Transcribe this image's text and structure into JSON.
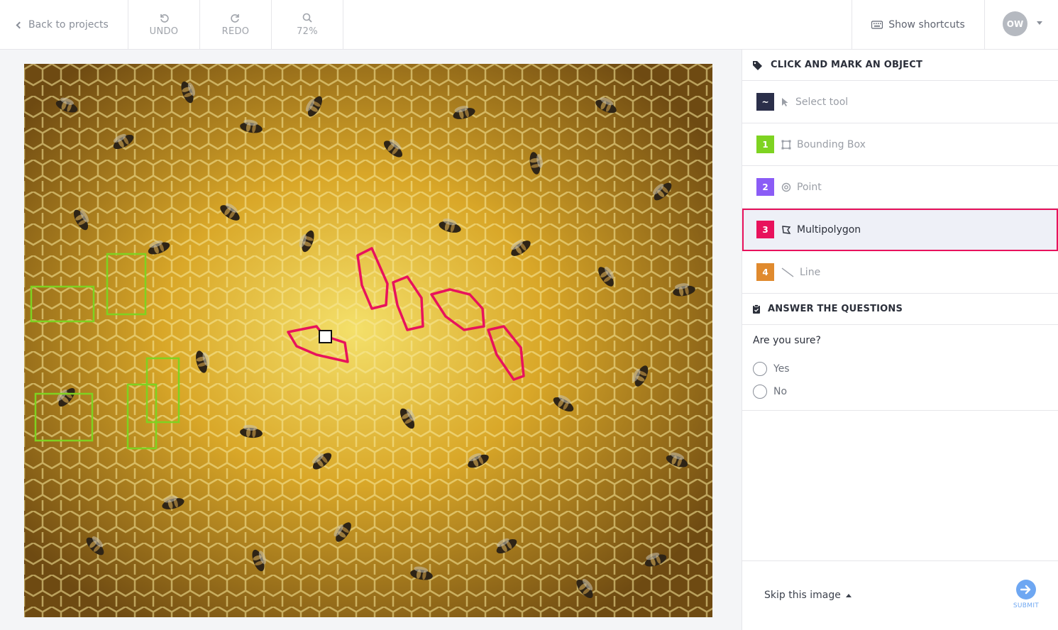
{
  "toolbar": {
    "back_label": "Back to projects",
    "undo_label": "UNDO",
    "redo_label": "REDO",
    "zoom_label": "72%",
    "shortcuts_label": "Show shortcuts",
    "avatar_initials": "OW"
  },
  "panel": {
    "objects_heading": "CLICK AND MARK AN OBJECT",
    "tools": [
      {
        "key": "~",
        "label": "Select tool",
        "color": "#2b2f4a",
        "icon": "cursor-icon"
      },
      {
        "key": "1",
        "label": "Bounding Box",
        "color": "#7ed321",
        "icon": "bounding-box-icon"
      },
      {
        "key": "2",
        "label": "Point",
        "color": "#8b5cf6",
        "icon": "point-icon"
      },
      {
        "key": "3",
        "label": "Multipolygon",
        "color": "#e8125c",
        "icon": "polygon-icon",
        "active": true
      },
      {
        "key": "4",
        "label": "Line",
        "color": "#e08a2e",
        "icon": "line-icon"
      }
    ],
    "questions_heading": "ANSWER THE QUESTIONS",
    "question": "Are you sure?",
    "options": [
      "Yes",
      "No"
    ],
    "skip_label": "Skip this image",
    "submit_label": "SUBMIT"
  },
  "annotations": {
    "box_color": "#7ed321",
    "polygon_color": "#e8125c"
  }
}
